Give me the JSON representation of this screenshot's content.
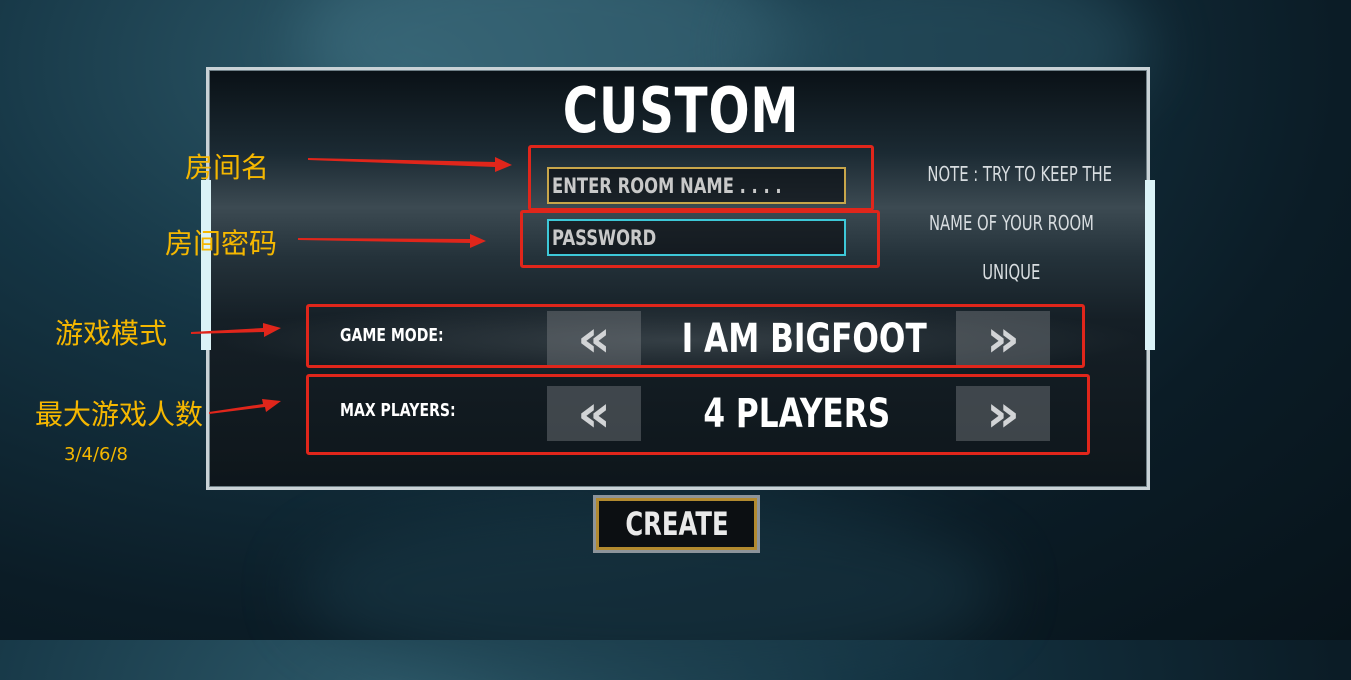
{
  "panel": {
    "title": "CUSTOM",
    "room_name": {
      "placeholder": "ENTER ROOM NAME . . . ."
    },
    "password": {
      "placeholder": "PASSWORD"
    },
    "note_lines": [
      "NOTE : TRY TO KEEP THE",
      "NAME OF YOUR ROOM",
      "UNIQUE"
    ],
    "game_mode": {
      "label": "GAME MODE:",
      "value": "I AM BIGFOOT",
      "prev": "«",
      "next": "»"
    },
    "max_players": {
      "label": "MAX PLAYERS:",
      "value": "4 PLAYERS",
      "prev": "«",
      "next": "»"
    }
  },
  "create_button": {
    "label": "CREATE"
  },
  "annotations": {
    "room_name": "房间名",
    "password": "房间密码",
    "game_mode": "游戏模式",
    "max_players": "最大游戏人数",
    "max_players_options": "3/4/6/8"
  },
  "colors": {
    "annotation_text": "#f5b700",
    "annotation_box": "#e0261b",
    "room_field_border": "#c8a64a",
    "password_field_border": "#3dc8d8"
  },
  "icons": {
    "prev": "double-chevron-left-icon",
    "next": "double-chevron-right-icon"
  }
}
